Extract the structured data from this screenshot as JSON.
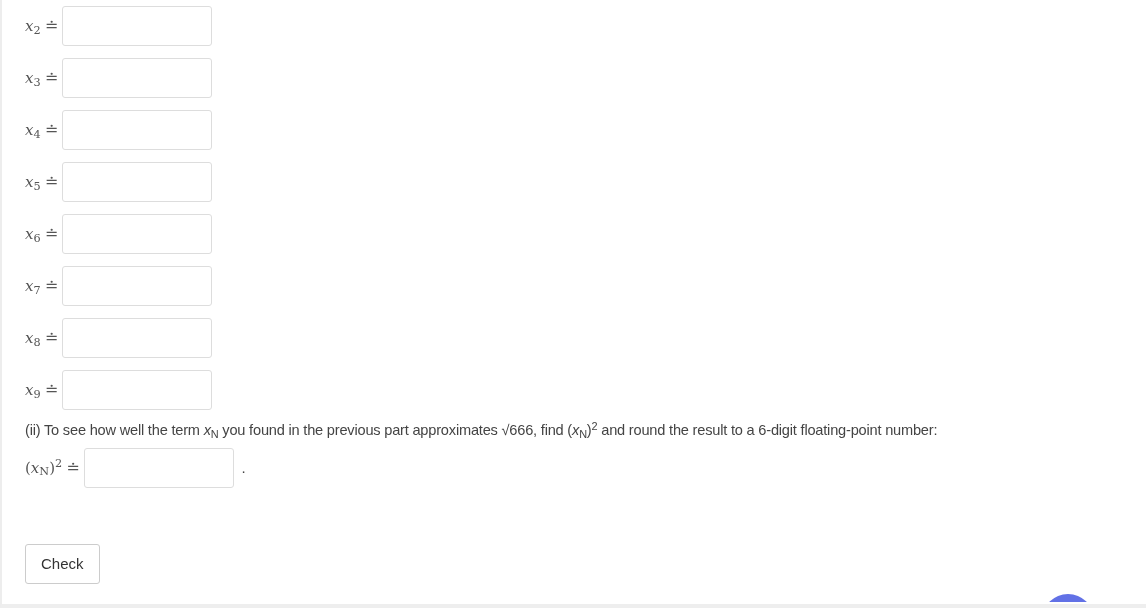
{
  "rows": [
    {
      "label": "*x*$_{2}$",
      "relation": "≐"
    },
    {
      "label": "*x*$_{3}$",
      "relation": "≐"
    },
    {
      "label": "*x*$_{4}$",
      "relation": "≐"
    },
    {
      "label": "*x*$_{5}$",
      "relation": "≐"
    },
    {
      "label": "*x*$_{6}$",
      "relation": "≐"
    },
    {
      "label": "*x*$_{7}$",
      "relation": "≐"
    },
    {
      "label": "*x*$_{8}$",
      "relation": "≐"
    },
    {
      "label": "*x*$_{9}$",
      "relation": "≐"
    }
  ],
  "question": "(ii) To see how well the term *x*$_{N}$ you found in the previous part approximates √666, find (*x*$_{N}$)$^{2}$ and round the result to a 6-digit floating-point number:",
  "answer": {
    "label": "(*x*$_{N}$)$^{2}$",
    "relation": "≐",
    "after": "."
  },
  "button": "Check"
}
